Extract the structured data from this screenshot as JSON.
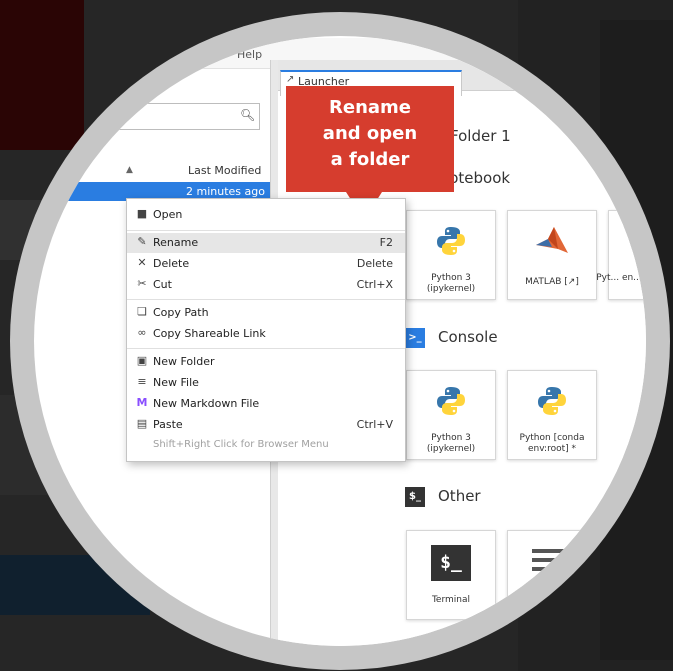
{
  "file_browser": {
    "menu_fragment": "Help",
    "column_last_modified": "Last Modified",
    "selected_row_modified": "2 minutes ago"
  },
  "launcher": {
    "tab_label": "Launcher",
    "folder_title": "Folder 1",
    "sections": {
      "notebook": "Notebook",
      "console": "Console",
      "other": "Other"
    },
    "notebook_cards": [
      {
        "label": "Python 3 (ipykernel)",
        "icon": "python-logo"
      },
      {
        "label": "MATLAB [↗]",
        "icon": "matlab-logo"
      },
      {
        "label": "Pyt... en...",
        "icon": "python-logo"
      }
    ],
    "console_cards": [
      {
        "label": "Python 3 (ipykernel)",
        "icon": "python-logo"
      },
      {
        "label": "Python [conda env:root] *",
        "icon": "python-logo"
      }
    ],
    "other_cards": [
      {
        "label": "Terminal",
        "icon": "terminal-icon"
      },
      {
        "label": "",
        "icon": "text-file-icon"
      }
    ]
  },
  "callout": {
    "line1": "Rename",
    "line2": "and open",
    "line3": "a folder"
  },
  "context_menu": {
    "items": [
      {
        "label": "Open",
        "shortcut": "",
        "icon": "folder-icon"
      },
      {
        "label": "Rename",
        "shortcut": "F2",
        "icon": "pencil-icon",
        "highlighted": true
      },
      {
        "label": "Delete",
        "shortcut": "Delete",
        "icon": "x-icon"
      },
      {
        "label": "Cut",
        "shortcut": "Ctrl+X",
        "icon": "scissors-icon"
      },
      {
        "label": "Copy Path",
        "shortcut": "",
        "icon": "copy-icon"
      },
      {
        "label": "Copy Shareable Link",
        "shortcut": "",
        "icon": "link-icon"
      },
      {
        "label": "New Folder",
        "shortcut": "",
        "icon": "new-folder-icon"
      },
      {
        "label": "New File",
        "shortcut": "",
        "icon": "new-file-icon"
      },
      {
        "label": "New Markdown File",
        "shortcut": "",
        "icon": "markdown-icon"
      },
      {
        "label": "Paste",
        "shortcut": "Ctrl+V",
        "icon": "paste-icon"
      }
    ],
    "hint": "Shift+Right Click for Browser Menu"
  },
  "colors": {
    "selection_blue": "#2a7de1",
    "callout_red": "#d63d2e",
    "ring_gray": "#c6c6c6"
  }
}
